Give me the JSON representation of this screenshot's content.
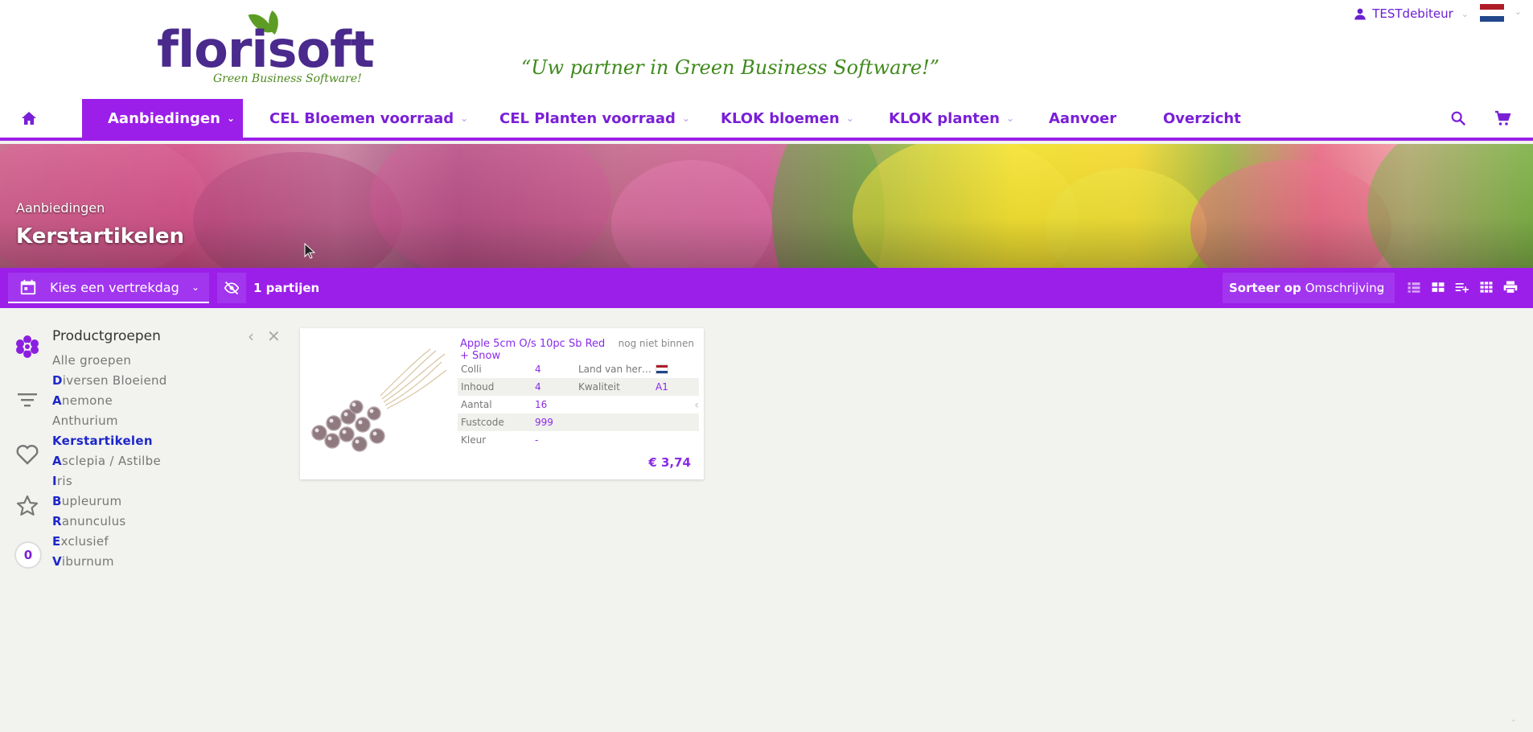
{
  "header": {
    "logo_text_1": "flori",
    "logo_text_2": "soft",
    "logo_tagline": "Green Business Software!",
    "slogan": "“Uw partner in Green Business Software!”",
    "user_name": "TESTdebiteur",
    "language_flag_colors": [
      "#ae1c28",
      "#ffffff",
      "#21468b"
    ]
  },
  "nav": {
    "home_icon": "home-icon",
    "items": [
      {
        "label": "Aanbiedingen",
        "has_dropdown": true,
        "active": true
      },
      {
        "label": "CEL Bloemen voorraad",
        "has_dropdown": true
      },
      {
        "label": "CEL Planten voorraad",
        "has_dropdown": true
      },
      {
        "label": "KLOK bloemen",
        "has_dropdown": true
      },
      {
        "label": "KLOK planten",
        "has_dropdown": true
      },
      {
        "label": "Aanvoer"
      },
      {
        "label": "Overzicht"
      }
    ],
    "search_icon": "search-icon",
    "cart_icon": "cart-icon"
  },
  "banner": {
    "breadcrumb": "Aanbiedingen",
    "title": "Kerstartikelen"
  },
  "toolbar": {
    "date_placeholder": "Kies een vertrekdag",
    "lot_count": "1 partijen",
    "sort_prefix": "Sorteer op",
    "sort_value": "Omschrijving",
    "view_icons": [
      "list-view-icon",
      "grid-view-icon",
      "playlist-add-icon",
      "small-grid-icon",
      "print-icon"
    ]
  },
  "rail": {
    "icons": [
      "flower-icon",
      "filter-icon",
      "heart-icon",
      "star-icon"
    ],
    "count": "0"
  },
  "groups": {
    "title": "Productgroepen",
    "items": [
      {
        "first": "A",
        "rest": "lle groepen",
        "style": "plain"
      },
      {
        "first": "D",
        "rest": "iversen Bloeiend",
        "style": "letter"
      },
      {
        "first": "A",
        "rest": "nemone",
        "style": "letter"
      },
      {
        "first": "A",
        "rest": "nthurium",
        "style": "plain"
      },
      {
        "first": "K",
        "rest": "erstartikelen",
        "style": "current"
      },
      {
        "first": "A",
        "rest": "sclepia / Astilbe",
        "style": "letter"
      },
      {
        "first": "I",
        "rest": "ris",
        "style": "letter"
      },
      {
        "first": "B",
        "rest": "upleurum",
        "style": "letter"
      },
      {
        "first": "R",
        "rest": "anunculus",
        "style": "letter"
      },
      {
        "first": "E",
        "rest": "xclusief",
        "style": "letter"
      },
      {
        "first": "V",
        "rest": "iburnum",
        "style": "letter"
      }
    ]
  },
  "product": {
    "title": "Apple 5cm O/s 10pc Sb Red + Snow",
    "status": "nog niet binnen",
    "rows": [
      {
        "k": "Colli",
        "v": "4",
        "k2": "Land van herk...",
        "v2": "",
        "v2_flag": true,
        "shade": false
      },
      {
        "k": "Inhoud",
        "v": "4",
        "k2": "Kwaliteit",
        "v2": "A1",
        "shade": true
      },
      {
        "k": "Aantal",
        "v": "16",
        "k2": "",
        "v2": "",
        "shade": false
      },
      {
        "k": "Fustcode",
        "v": "999",
        "k2": "",
        "v2": "",
        "shade": true
      },
      {
        "k": "Kleur",
        "v": "-",
        "k2": "",
        "v2": "",
        "shade": false
      }
    ],
    "price": "€ 3,74",
    "colors": {
      "accent": "#9b1fe8",
      "link": "#8a2be8",
      "group_letter": "#1d27c9"
    }
  }
}
